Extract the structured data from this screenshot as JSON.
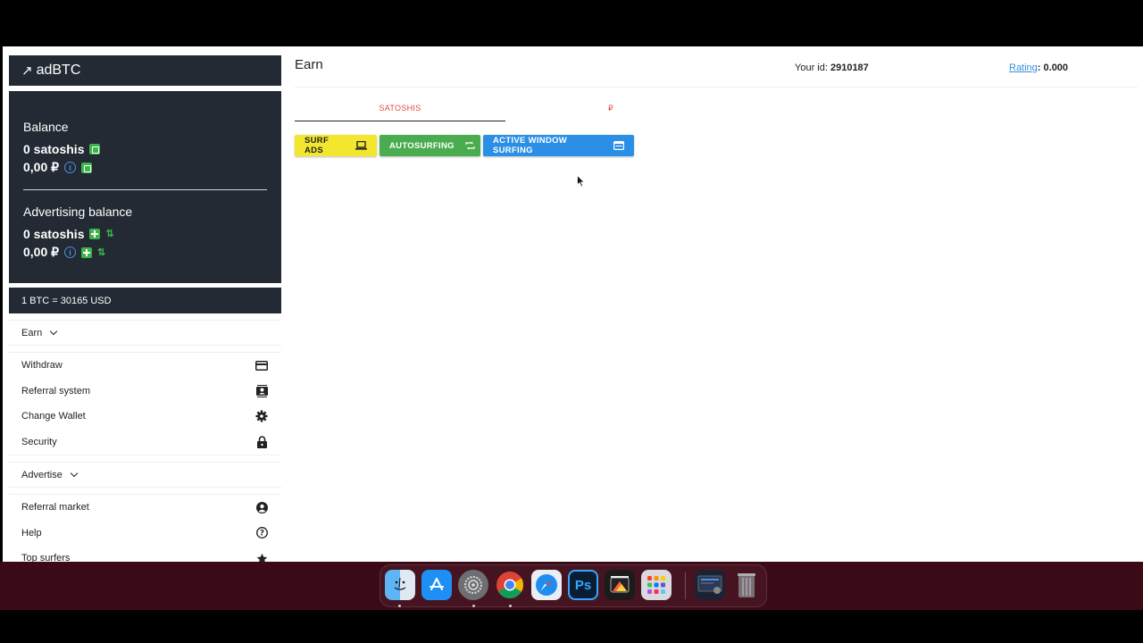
{
  "sidebar": {
    "logo": "adBTC",
    "balance": {
      "heading": "Balance",
      "satoshis": "0 satoshis",
      "rub": "0,00 ₽"
    },
    "advertising": {
      "heading": "Advertising balance",
      "satoshis": "0 satoshis",
      "rub": "0,00 ₽"
    },
    "rate": "1 BTC = 30165 USD",
    "earn_label": "Earn",
    "group1": [
      {
        "label": "Withdraw",
        "icon": "credit-card-icon"
      },
      {
        "label": "Referral system",
        "icon": "contacts-icon"
      },
      {
        "label": "Change Wallet",
        "icon": "gear-icon"
      },
      {
        "label": "Security",
        "icon": "lock-icon"
      }
    ],
    "advertise_label": "Advertise",
    "group2": [
      {
        "label": "Referral market",
        "icon": "user-circle-icon"
      },
      {
        "label": "Help",
        "icon": "help-icon"
      },
      {
        "label": "Top surfers",
        "icon": "star-icon"
      }
    ]
  },
  "header": {
    "title": "Earn",
    "your_id_label": "Your id:",
    "your_id_value": "2910187",
    "rating_label": "Rating",
    "rating_value": ": 0.000"
  },
  "tabs": [
    {
      "label": "SATOSHIS",
      "active": true
    },
    {
      "label": "₽",
      "active": false
    }
  ],
  "buttons": {
    "surf_ads": "SURF ADS",
    "autosurfing": "AUTOSURFING",
    "active_window": "ACTIVE WINDOW SURFING"
  },
  "colors": {
    "sidebar_dark": "#232a33",
    "accent_green": "#3cb44b",
    "yellow": "#f3e62f",
    "green": "#4aac4f",
    "blue": "#2c8fe6",
    "tab_red": "#e04a4a"
  },
  "dock": {
    "apps": [
      "finder-icon",
      "app-store-icon",
      "system-settings-icon",
      "chrome-icon",
      "safari-icon",
      "photoshop-icon",
      "final-cut-icon",
      "launchpad-icon",
      "screen-recorder-icon",
      "trash-icon"
    ]
  }
}
